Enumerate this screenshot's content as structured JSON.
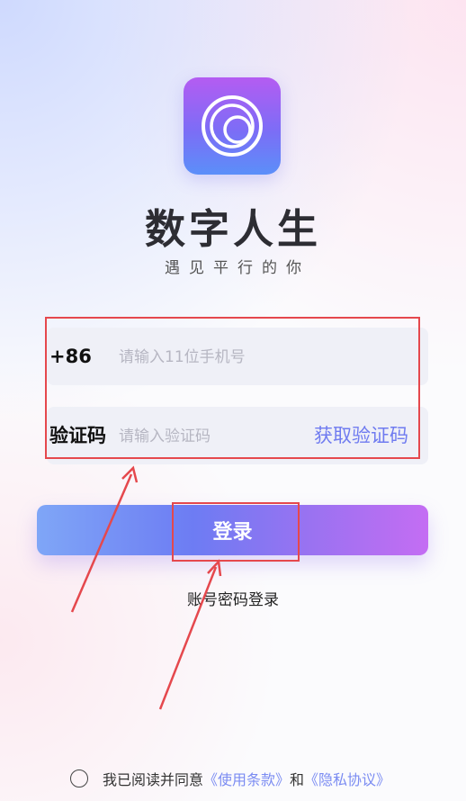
{
  "app": {
    "title": "数字人生",
    "subtitle": "遇见平行的你"
  },
  "form": {
    "phone": {
      "prefix": "+86",
      "placeholder": "请输入11位手机号",
      "value": ""
    },
    "code": {
      "label": "验证码",
      "placeholder": "请输入验证码",
      "value": "",
      "get_code_label": "获取验证码"
    }
  },
  "login_button_label": "登录",
  "password_login_label": "账号密码登录",
  "agreement": {
    "text_prefix": "我已阅读并同意",
    "terms_link": "《使用条款》",
    "and": "和",
    "privacy_link": "《隐私协议》",
    "checked": false
  },
  "colors": {
    "accent": "#6f7bf0",
    "annotation": "#e5484d",
    "icon_gradient": [
      "#b45cf2",
      "#5b8ff9"
    ],
    "button_gradient": [
      "#7fa6f7",
      "#c46df3"
    ]
  },
  "icons": {
    "app_logo": "concentric-rings-icon",
    "agreement_checkbox": "circle-checkbox-icon"
  }
}
